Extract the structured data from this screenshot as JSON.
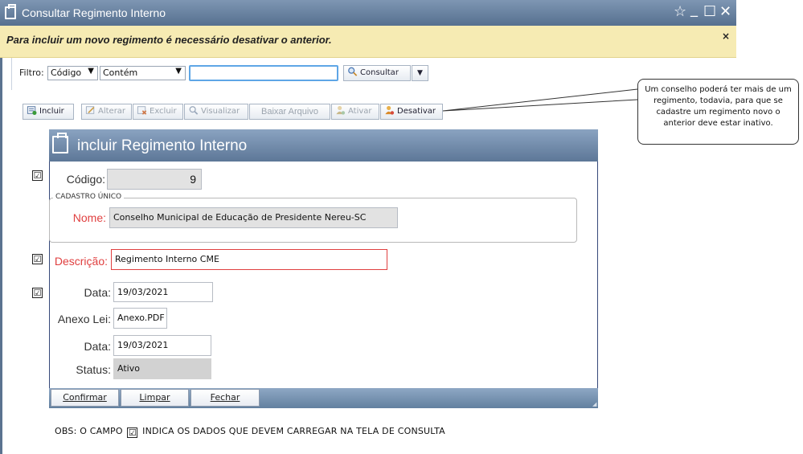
{
  "window": {
    "title": "Consultar Regimento Interno",
    "controls": {
      "favorite": "☆",
      "minimize": "_",
      "maximize": "☐",
      "close": "✕"
    }
  },
  "notice": {
    "text": "Para incluir um novo regimento é necessário desativar o anterior.",
    "close": "×"
  },
  "filter": {
    "label": "Filtro:",
    "field_select": "Código",
    "operator_select": "Contém",
    "search_value": "",
    "consult_button": "Consultar"
  },
  "toolbar": {
    "incluir": "Incluir",
    "alterar": "Alterar",
    "excluir": "Excluir",
    "visualizar": "Visualizar",
    "baixar": "Baixar Arquivo",
    "ativar": "Ativar",
    "desativar": "Desativar"
  },
  "callout": {
    "text": "Um conselho poderá ter mais de um regimento, todavia, para que se cadastre um regimento novo o anterior deve estar inativo."
  },
  "dialog": {
    "title": "incluir Regimento Interno",
    "codigo_label": "Código:",
    "codigo_value": "9",
    "group_label": "CADASTRO ÚNICO",
    "nome_label": "Nome:",
    "nome_value": "Conselho Municipal de Educação de Presidente Nereu-SC",
    "descricao_label": "Descrição:",
    "descricao_value": "Regimento Interno CME",
    "data_label": "Data:",
    "data_value": "19/03/2021",
    "anexo_label": "Anexo Lei:",
    "anexo_value": "Anexo.PDF",
    "data2_label": "Data:",
    "data2_value": "19/03/2021",
    "status_label": "Status:",
    "status_value": "Ativo",
    "btn_confirmar": "Confirmar",
    "btn_limpar": "Limpar",
    "btn_fechar": "Fechar"
  },
  "checkmark": "☑",
  "obs": {
    "before": "OBS: O CAMPO",
    "after": "INDICA OS DADOS QUE DEVEM CARREGAR NA TELA DE CONSULTA"
  },
  "colors": {
    "title_bar": "#5d7797",
    "notice_bg": "#f6ebb3",
    "required_label": "#e04040",
    "footer_bar": "#62809f"
  }
}
